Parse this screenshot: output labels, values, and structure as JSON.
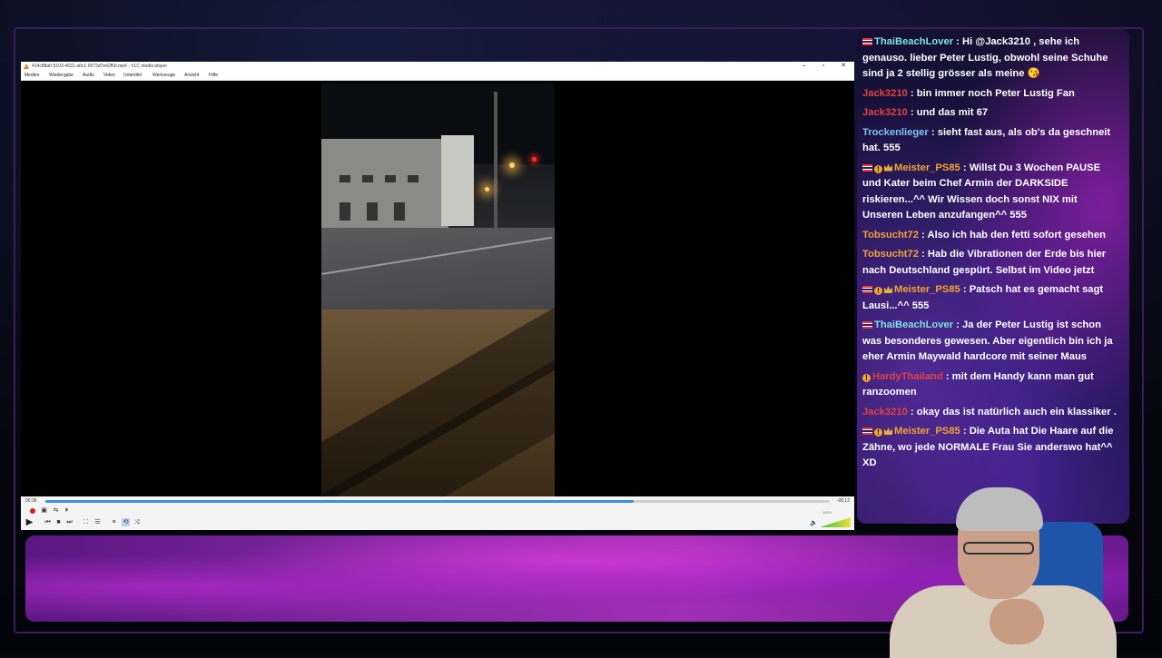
{
  "vlc": {
    "title": "414c88a0-5103-4631-a0c1-0072d7e42f6d.mp4 - VLC media player",
    "window_buttons": {
      "minimize": "–",
      "maximize": "▫",
      "close": "✕"
    },
    "menu": [
      "Medien",
      "Wiedergabe",
      "Audio",
      "Video",
      "Untertitel",
      "Werkzeuge",
      "Ansicht",
      "Hilfe"
    ],
    "time_elapsed": "00:36",
    "time_remaining": "-00:12",
    "progress": 0.75,
    "volume_label": "100%",
    "icons": [
      "record-icon",
      "snapshot-icon",
      "loop-ab-icon",
      "frame-step-icon",
      "play-icon",
      "prev-icon",
      "stop-icon",
      "next-icon",
      "fullscreen-icon",
      "extended-settings-icon",
      "playlist-icon",
      "loop-icon",
      "shuffle-icon",
      "volume-icon"
    ]
  },
  "chat": {
    "messages": [
      {
        "badges": [
          "flag"
        ],
        "user": "ThaiBeachLover",
        "user_color": "#7fe3e0",
        "text": "Hi @Jack3210 , sehe ich genauso. lieber Peter Lustig, obwohl seine Schuhe sind ja 2 stellig grösser als meine 😘"
      },
      {
        "badges": [],
        "user": "Jack3210",
        "user_color": "#e4413f",
        "text": "bin immer noch Peter Lustig Fan"
      },
      {
        "badges": [],
        "user": "Jack3210",
        "user_color": "#e4413f",
        "text": "und das mit 67"
      },
      {
        "badges": [],
        "user": "Trockenlieger",
        "user_color": "#7cc3f2",
        "text": "sieht fast aus, als ob's da geschneit hat. 555"
      },
      {
        "badges": [
          "flag",
          "warn",
          "crown"
        ],
        "user": "Meister_PS85",
        "user_color": "#f2a530",
        "text": "Willst Du 3 Wochen PAUSE und Kater beim Chef Armin der DARKSIDE riskieren...^^ Wir Wissen doch sonst NIX mit Unseren Leben anzufangen^^ 555"
      },
      {
        "badges": [],
        "user": "Tobsucht72",
        "user_color": "#f2a530",
        "text": "Also ich hab den fetti sofort gesehen"
      },
      {
        "badges": [],
        "user": "Tobsucht72",
        "user_color": "#f2a530",
        "text": "Hab die Vibrationen der Erde bis hier nach Deutschland gespürt. Selbst im Video jetzt"
      },
      {
        "badges": [
          "flag",
          "warn",
          "crown"
        ],
        "user": "Meister_PS85",
        "user_color": "#f2a530",
        "text": "Patsch hat es gemacht sagt Lausi...^^ 555"
      },
      {
        "badges": [
          "flag"
        ],
        "user": "ThaiBeachLover",
        "user_color": "#7fe3e0",
        "text": "Ja der Peter Lustig ist schon was besonderes gewesen. Aber eigentlich bin ich ja eher Armin Maywald hardcore mit seiner Maus"
      },
      {
        "badges": [
          "warn"
        ],
        "user": "HardyThailand",
        "user_color": "#e4413f",
        "text": "mit dem Handy kann man gut ranzoomen"
      },
      {
        "badges": [],
        "user": "Jack3210",
        "user_color": "#e4413f",
        "text": "okay das ist natürlich auch ein klassiker ."
      },
      {
        "badges": [
          "flag",
          "warn",
          "crown"
        ],
        "user": "Meister_PS85",
        "user_color": "#f2a530",
        "text": "Die Auta hat Die Haare auf die Zähne, wo jede NORMALE Frau Sie anderswo hat^^ XD"
      }
    ]
  }
}
